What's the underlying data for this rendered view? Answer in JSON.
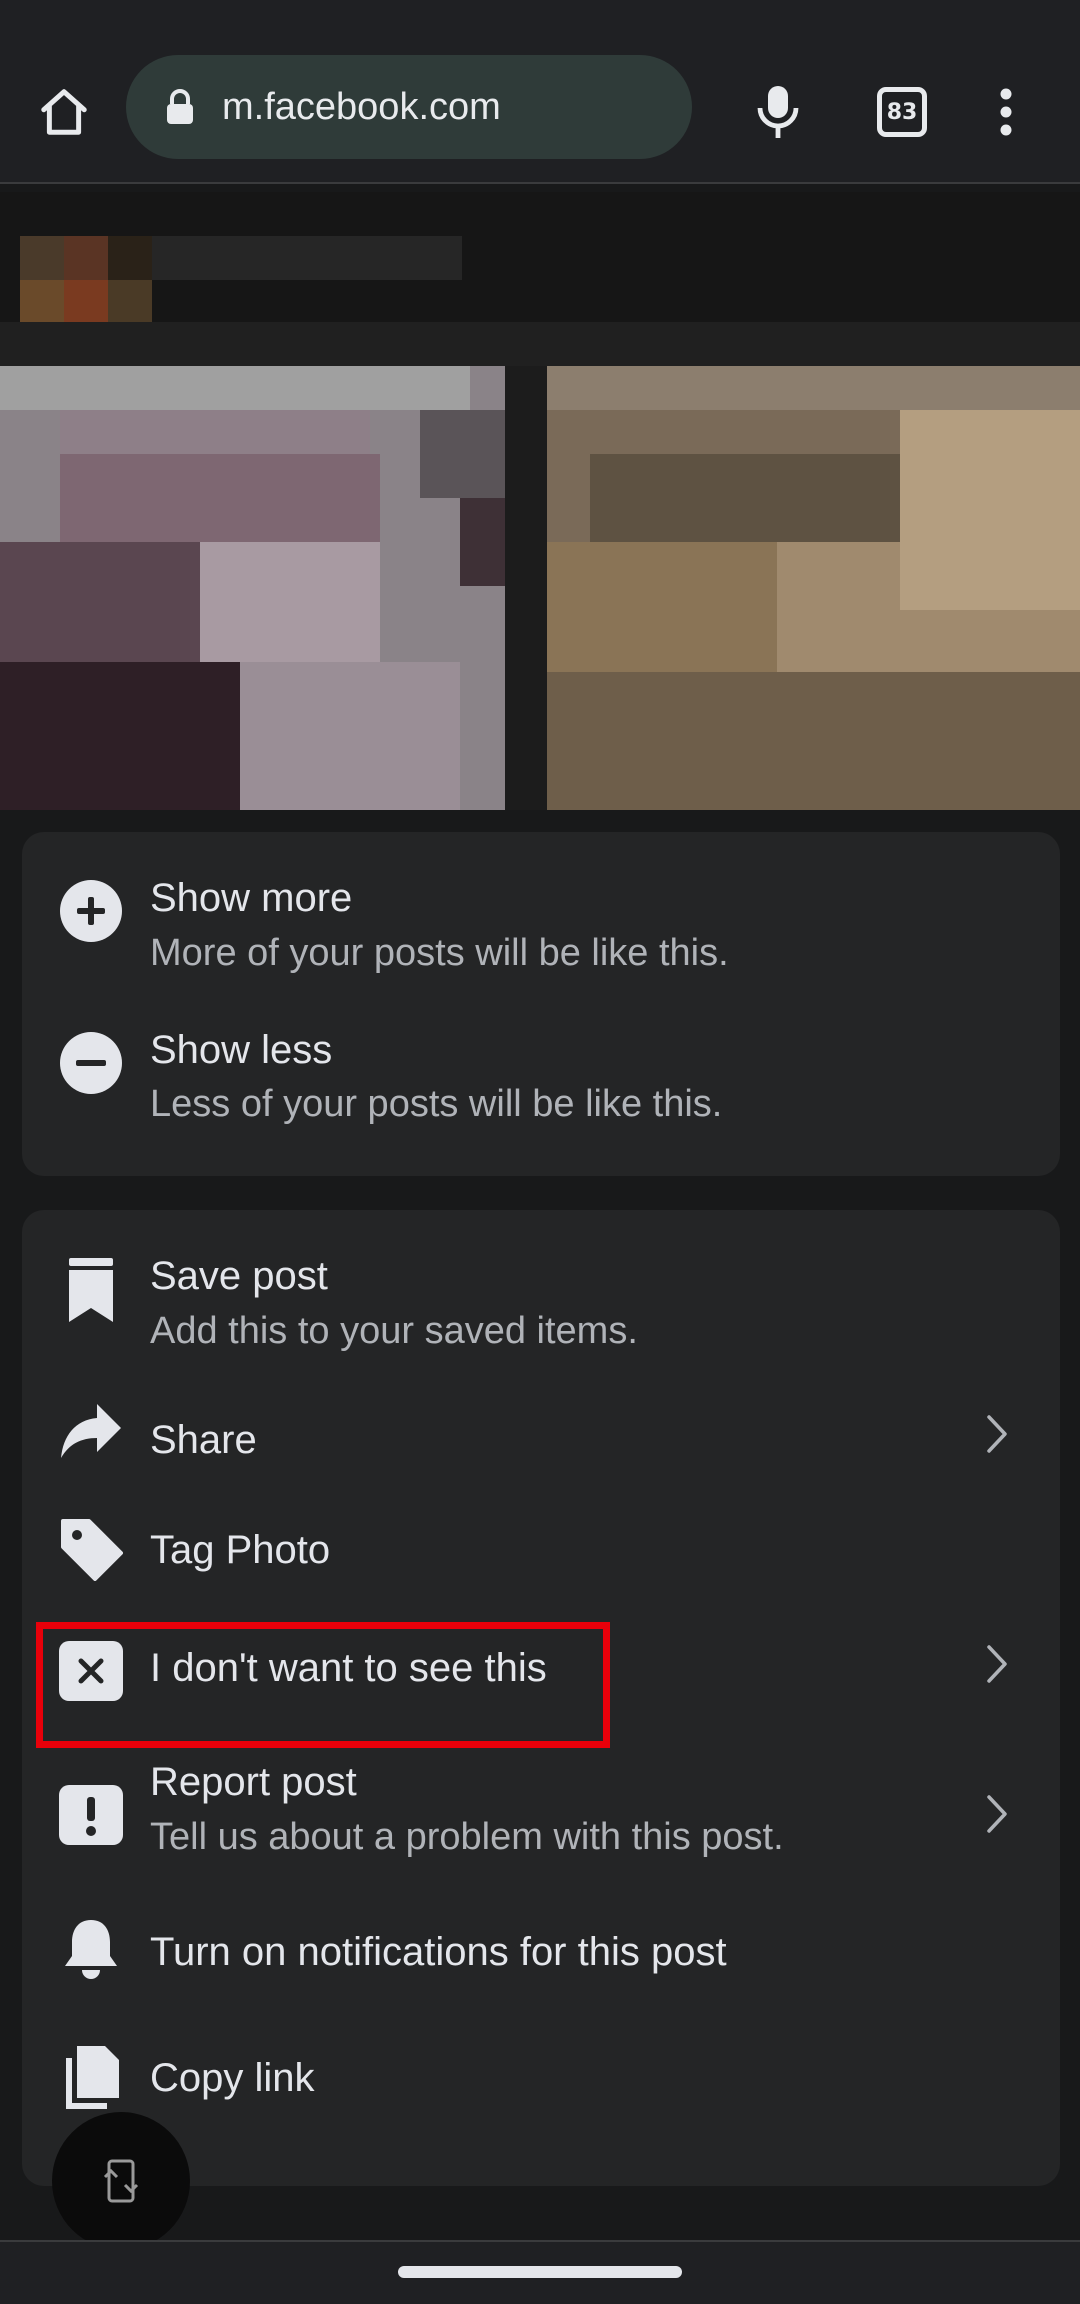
{
  "browser": {
    "url": "m.facebook.com",
    "tab_count": "83",
    "icons": [
      "home-icon",
      "lock-icon",
      "mic-icon",
      "tabs-icon",
      "more-vert-icon"
    ]
  },
  "feedback_menu": {
    "items": [
      {
        "title": "Show more",
        "subtitle": "More of your posts will be like this.",
        "icon": "plus-circle-icon"
      },
      {
        "title": "Show less",
        "subtitle": "Less of your posts will be like this.",
        "icon": "minus-circle-icon"
      }
    ]
  },
  "actions_menu": {
    "items": [
      {
        "title": "Save post",
        "subtitle": "Add this to your saved items.",
        "icon": "bookmark-icon"
      },
      {
        "title": "Share",
        "icon": "share-icon",
        "has_chevron": true
      },
      {
        "title": "Tag Photo",
        "icon": "tag-icon"
      },
      {
        "title": "I don't want to see this",
        "icon": "close-box-icon",
        "has_chevron": true,
        "highlighted": true
      },
      {
        "title": "Report post",
        "subtitle": "Tell us about a problem with this post.",
        "icon": "alert-box-icon",
        "has_chevron": true
      },
      {
        "title": "Turn on notifications for this post",
        "icon": "bell-icon"
      },
      {
        "title": "Copy link",
        "icon": "copy-icon"
      }
    ]
  },
  "colors": {
    "highlight": "#e8000a",
    "sheet": "#242526",
    "background": "#18191a"
  }
}
